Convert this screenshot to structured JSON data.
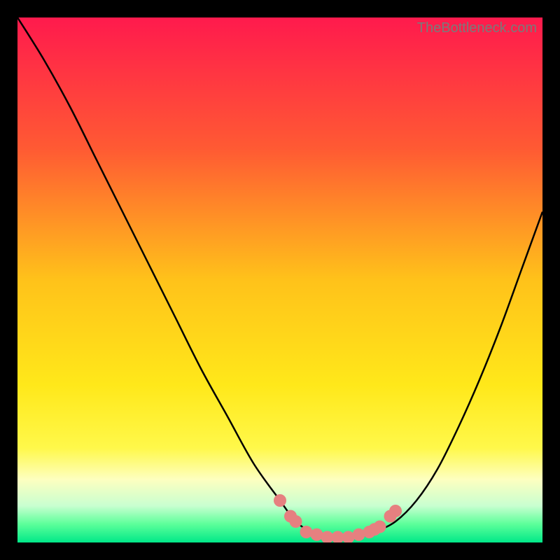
{
  "watermark": "TheBottleneck.com",
  "chart_data": {
    "type": "line",
    "title": "",
    "xlabel": "",
    "ylabel": "",
    "xlim": [
      0,
      100
    ],
    "ylim": [
      0,
      100
    ],
    "grid": false,
    "legend": false,
    "background_gradient": {
      "stops": [
        {
          "offset": 0.0,
          "color": "#ff1a4d"
        },
        {
          "offset": 0.25,
          "color": "#ff5a33"
        },
        {
          "offset": 0.5,
          "color": "#ffc21a"
        },
        {
          "offset": 0.7,
          "color": "#ffe81a"
        },
        {
          "offset": 0.82,
          "color": "#fff84a"
        },
        {
          "offset": 0.88,
          "color": "#fdffc0"
        },
        {
          "offset": 0.93,
          "color": "#c9ffd0"
        },
        {
          "offset": 0.965,
          "color": "#5cff9a"
        },
        {
          "offset": 1.0,
          "color": "#00e888"
        }
      ]
    },
    "series": [
      {
        "name": "curve",
        "color": "#000000",
        "x": [
          0,
          5,
          10,
          15,
          20,
          25,
          30,
          35,
          40,
          45,
          50,
          53,
          56,
          59,
          62,
          65,
          68,
          72,
          76,
          80,
          84,
          88,
          92,
          96,
          100
        ],
        "values": [
          100,
          92,
          83,
          73,
          63,
          53,
          43,
          33,
          24,
          15,
          8,
          4,
          2,
          1,
          1,
          1,
          2,
          4,
          8,
          14,
          22,
          31,
          41,
          52,
          63
        ]
      }
    ],
    "markers": {
      "name": "highlight-dots",
      "color": "#e68080",
      "points": [
        {
          "x": 50,
          "y": 8
        },
        {
          "x": 52,
          "y": 5
        },
        {
          "x": 53,
          "y": 4
        },
        {
          "x": 55,
          "y": 2
        },
        {
          "x": 57,
          "y": 1.5
        },
        {
          "x": 59,
          "y": 1
        },
        {
          "x": 61,
          "y": 1
        },
        {
          "x": 63,
          "y": 1
        },
        {
          "x": 65,
          "y": 1.5
        },
        {
          "x": 67,
          "y": 2
        },
        {
          "x": 68,
          "y": 2.5
        },
        {
          "x": 69,
          "y": 3
        },
        {
          "x": 71,
          "y": 5
        },
        {
          "x": 72,
          "y": 6
        }
      ]
    }
  }
}
